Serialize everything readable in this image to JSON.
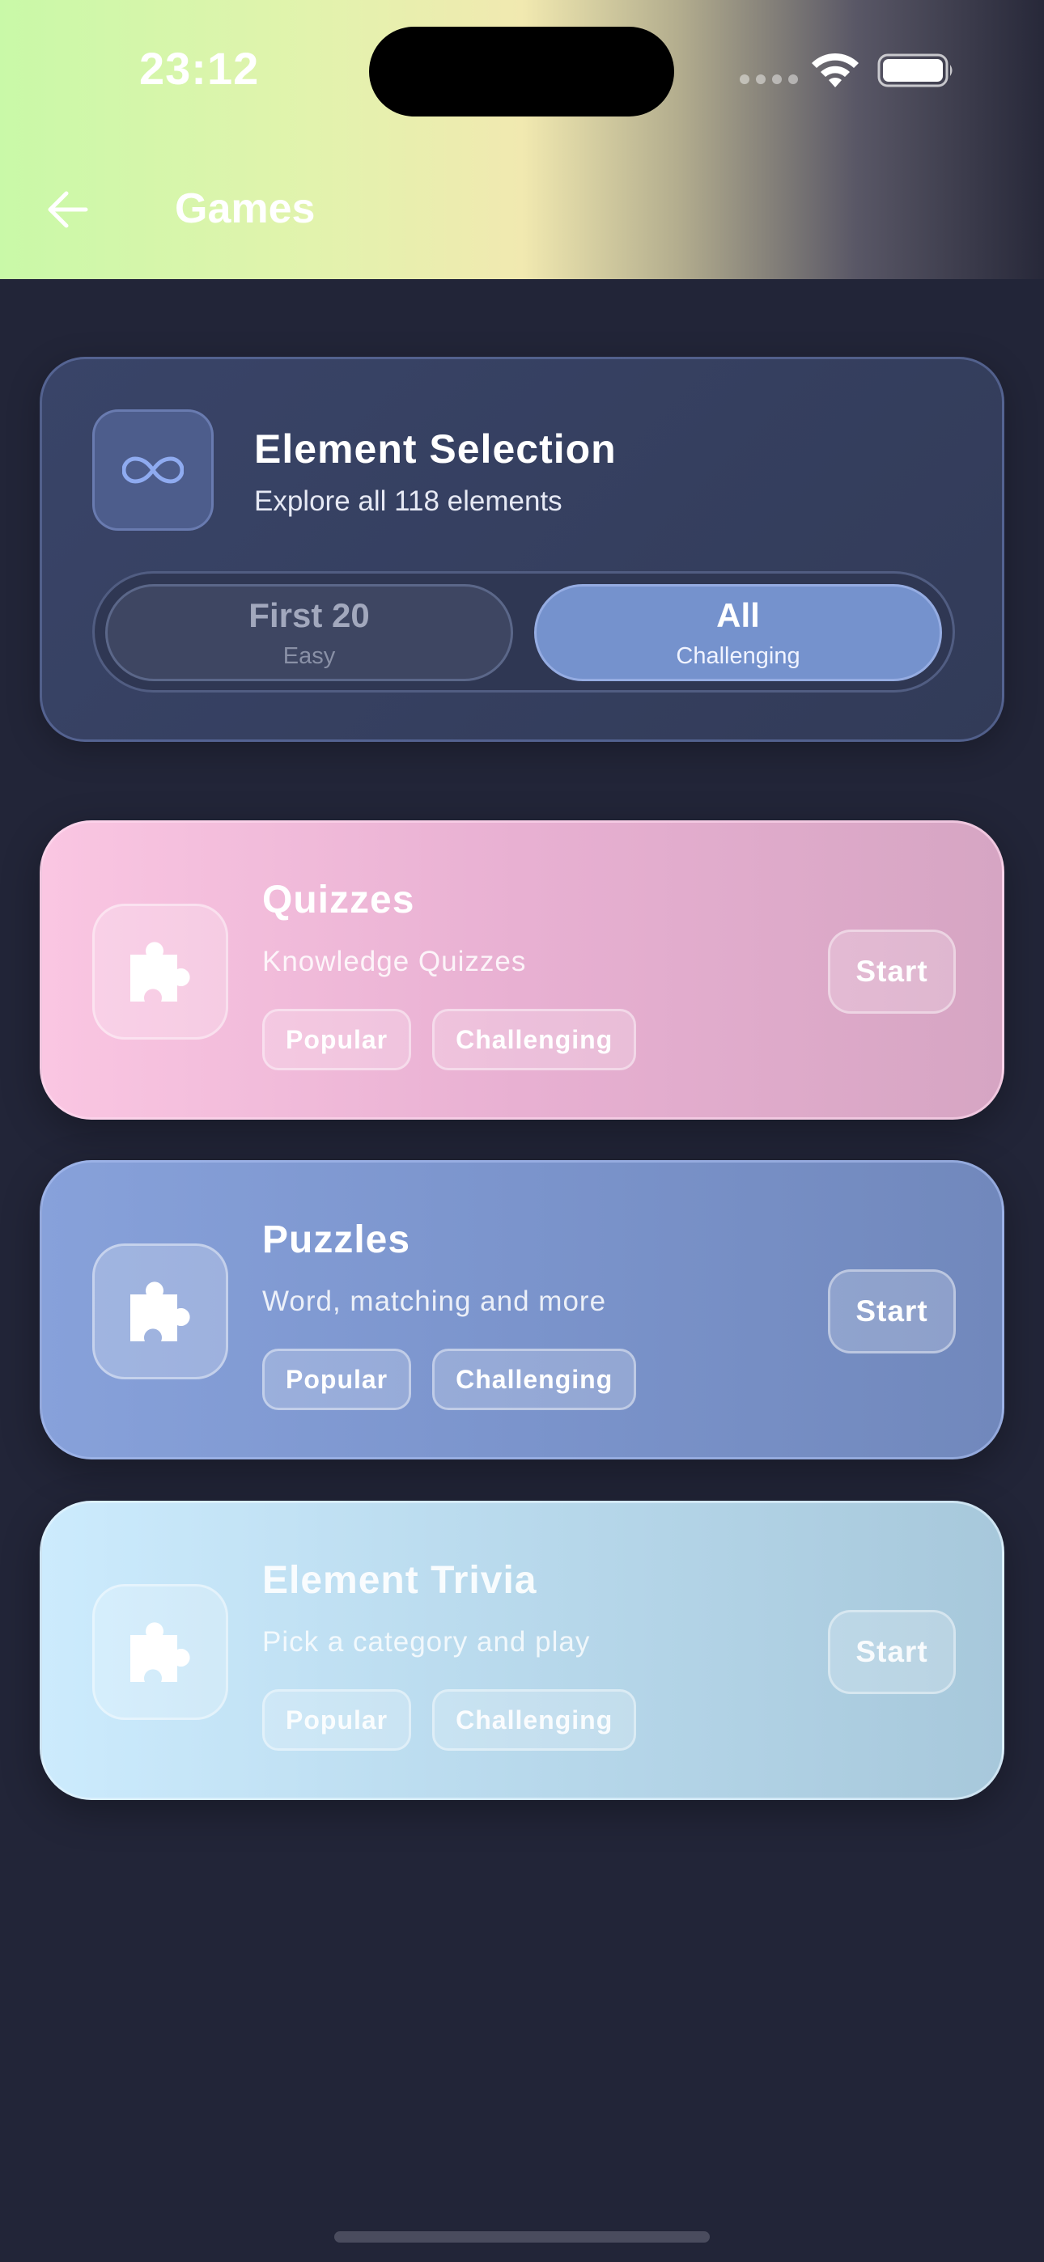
{
  "status_bar": {
    "time": "23:12"
  },
  "header": {
    "title": "Games"
  },
  "element_selection": {
    "title": "Element Selection",
    "subtitle": "Explore all 118 elements",
    "options": [
      {
        "label": "First 20",
        "hint": "Easy",
        "selected": false
      },
      {
        "label": "All",
        "hint": "Challenging",
        "selected": true
      }
    ]
  },
  "games": [
    {
      "title": "Quizzes",
      "subtitle": "Knowledge Quizzes",
      "tags": [
        "Popular",
        "Challenging"
      ],
      "start_label": "Start",
      "icon": "puzzle-icon",
      "color": "#fac6e2"
    },
    {
      "title": "Puzzles",
      "subtitle": "Word, matching and more",
      "tags": [
        "Popular",
        "Challenging"
      ],
      "start_label": "Start",
      "icon": "puzzle-icon",
      "color": "#87a1da"
    },
    {
      "title": "Element Trivia",
      "subtitle": "Pick a category and play",
      "tags": [
        "Popular",
        "Challenging"
      ],
      "start_label": "Start",
      "icon": "puzzle-icon",
      "color": "#ccebfd"
    }
  ],
  "theme": {
    "background": "#222538",
    "accent": "#7592cd"
  }
}
